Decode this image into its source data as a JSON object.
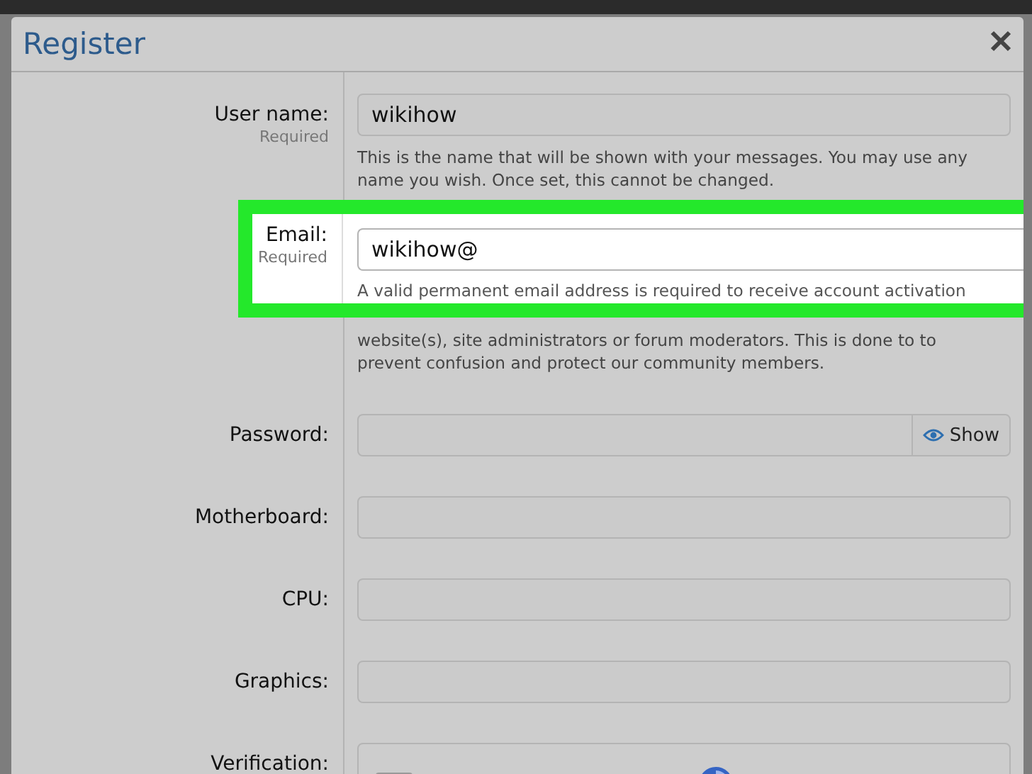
{
  "dialog": {
    "title": "Register"
  },
  "fields": [
    {
      "kind": "text",
      "label": "User name:",
      "note": "Required",
      "value": "wikihow",
      "highlighted": false,
      "hint": [
        "This is the name that will be shown with your messages. You may use any",
        "name you wish. Once set, this cannot be changed."
      ]
    },
    {
      "kind": "text",
      "label": "Email:",
      "note": "Required",
      "value": "wikihow@",
      "highlighted": true,
      "hint": [
        "A valid permanent email address is required to receive account activation"
      ],
      "hint_below": [
        "website(s), site administrators or forum moderators. This is done to to",
        "prevent confusion and protect our community members."
      ]
    },
    {
      "kind": "password",
      "label": "Password:",
      "highlighted": false,
      "toggle": "Show"
    },
    {
      "kind": "text",
      "label": "Motherboard:",
      "highlighted": false
    },
    {
      "kind": "text",
      "label": "CPU:",
      "highlighted": false
    },
    {
      "kind": "text",
      "label": "Graphics:",
      "highlighted": false
    },
    {
      "kind": "captcha",
      "label": "Verification:",
      "highlighted": false
    }
  ]
}
